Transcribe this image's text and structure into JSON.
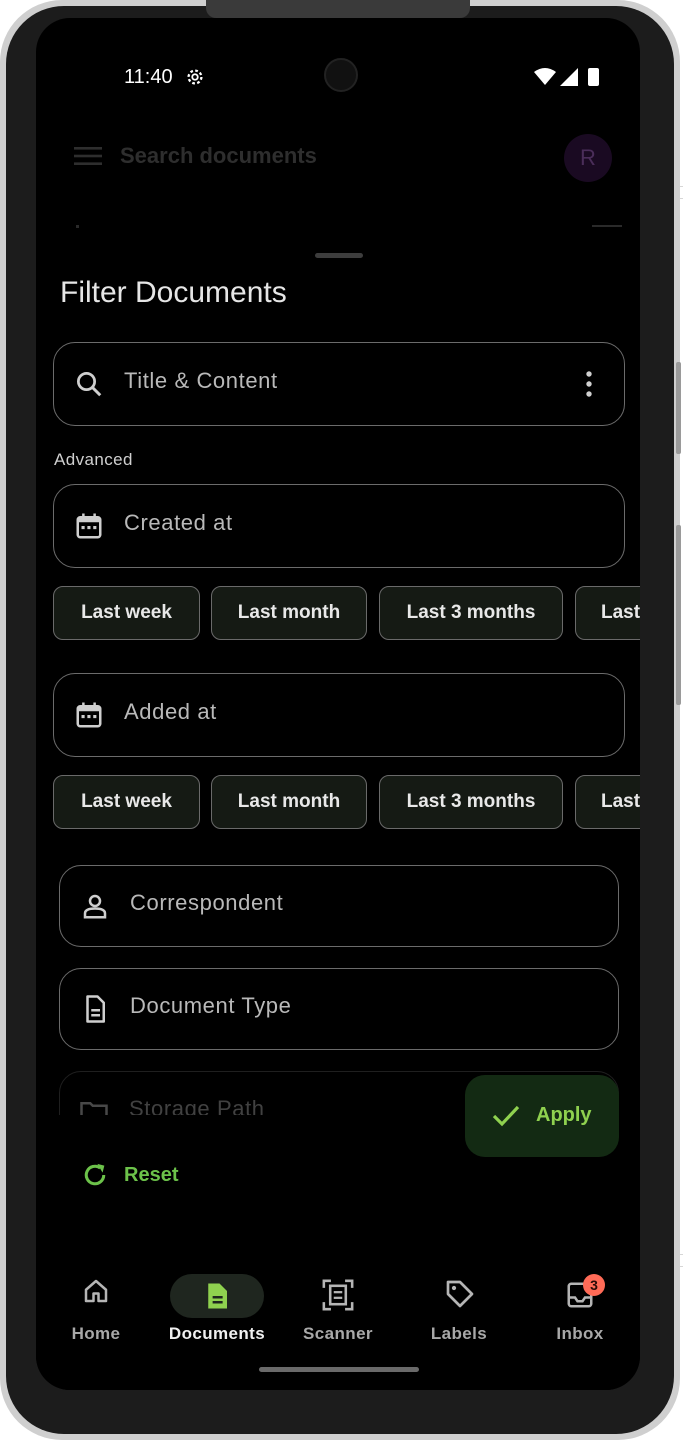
{
  "status_bar": {
    "time": "11:40"
  },
  "top_bar": {
    "search_placeholder": "Search documents",
    "avatar_initial": "R"
  },
  "sheet": {
    "title": "Filter Documents",
    "title_content_field": {
      "placeholder": "Title & Content"
    },
    "advanced_label": "Advanced",
    "created_at": {
      "label": "Created at",
      "chips": [
        "Last week",
        "Last month",
        "Last 3 months",
        "Last"
      ]
    },
    "added_at": {
      "label": "Added at",
      "chips": [
        "Last week",
        "Last month",
        "Last 3 months",
        "Last"
      ]
    },
    "correspondent": {
      "label": "Correspondent"
    },
    "document_type": {
      "label": "Document Type"
    },
    "storage_path": {
      "label": "Storage Path"
    },
    "apply_label": "Apply",
    "reset_label": "Reset"
  },
  "bottom_nav": {
    "items": [
      {
        "label": "Home",
        "icon": "home-icon"
      },
      {
        "label": "Documents",
        "icon": "document-icon",
        "selected": true
      },
      {
        "label": "Scanner",
        "icon": "scanner-icon"
      },
      {
        "label": "Labels",
        "icon": "label-icon"
      },
      {
        "label": "Inbox",
        "icon": "inbox-icon",
        "badge": "3"
      }
    ]
  },
  "colors": {
    "accent_green": "#8fd14f",
    "apply_bg": "#132a13",
    "badge": "#ff6b57",
    "selected_nav_bg": "#1f261f"
  }
}
